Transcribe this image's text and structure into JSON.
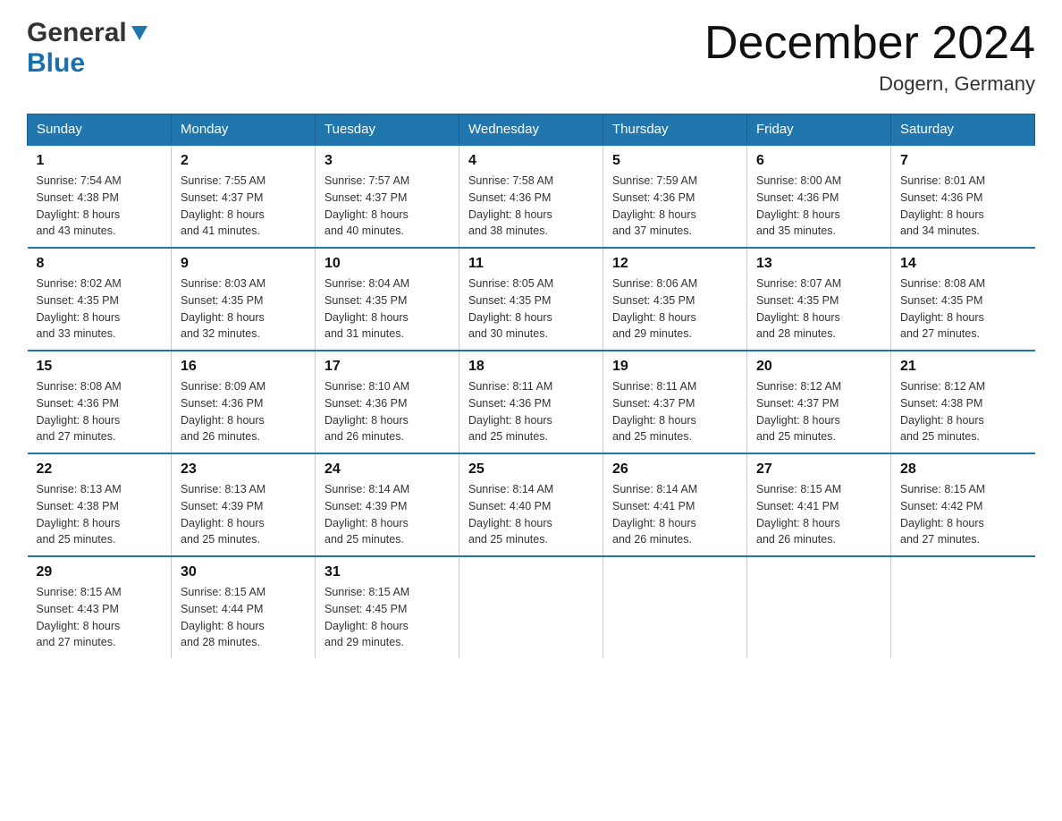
{
  "header": {
    "logo_line1": "General",
    "logo_line2": "Blue",
    "month_title": "December 2024",
    "location": "Dogern, Germany"
  },
  "days_of_week": [
    "Sunday",
    "Monday",
    "Tuesday",
    "Wednesday",
    "Thursday",
    "Friday",
    "Saturday"
  ],
  "weeks": [
    [
      {
        "day": "1",
        "sunrise": "7:54 AM",
        "sunset": "4:38 PM",
        "daylight": "8 hours and 43 minutes."
      },
      {
        "day": "2",
        "sunrise": "7:55 AM",
        "sunset": "4:37 PM",
        "daylight": "8 hours and 41 minutes."
      },
      {
        "day": "3",
        "sunrise": "7:57 AM",
        "sunset": "4:37 PM",
        "daylight": "8 hours and 40 minutes."
      },
      {
        "day": "4",
        "sunrise": "7:58 AM",
        "sunset": "4:36 PM",
        "daylight": "8 hours and 38 minutes."
      },
      {
        "day": "5",
        "sunrise": "7:59 AM",
        "sunset": "4:36 PM",
        "daylight": "8 hours and 37 minutes."
      },
      {
        "day": "6",
        "sunrise": "8:00 AM",
        "sunset": "4:36 PM",
        "daylight": "8 hours and 35 minutes."
      },
      {
        "day": "7",
        "sunrise": "8:01 AM",
        "sunset": "4:36 PM",
        "daylight": "8 hours and 34 minutes."
      }
    ],
    [
      {
        "day": "8",
        "sunrise": "8:02 AM",
        "sunset": "4:35 PM",
        "daylight": "8 hours and 33 minutes."
      },
      {
        "day": "9",
        "sunrise": "8:03 AM",
        "sunset": "4:35 PM",
        "daylight": "8 hours and 32 minutes."
      },
      {
        "day": "10",
        "sunrise": "8:04 AM",
        "sunset": "4:35 PM",
        "daylight": "8 hours and 31 minutes."
      },
      {
        "day": "11",
        "sunrise": "8:05 AM",
        "sunset": "4:35 PM",
        "daylight": "8 hours and 30 minutes."
      },
      {
        "day": "12",
        "sunrise": "8:06 AM",
        "sunset": "4:35 PM",
        "daylight": "8 hours and 29 minutes."
      },
      {
        "day": "13",
        "sunrise": "8:07 AM",
        "sunset": "4:35 PM",
        "daylight": "8 hours and 28 minutes."
      },
      {
        "day": "14",
        "sunrise": "8:08 AM",
        "sunset": "4:35 PM",
        "daylight": "8 hours and 27 minutes."
      }
    ],
    [
      {
        "day": "15",
        "sunrise": "8:08 AM",
        "sunset": "4:36 PM",
        "daylight": "8 hours and 27 minutes."
      },
      {
        "day": "16",
        "sunrise": "8:09 AM",
        "sunset": "4:36 PM",
        "daylight": "8 hours and 26 minutes."
      },
      {
        "day": "17",
        "sunrise": "8:10 AM",
        "sunset": "4:36 PM",
        "daylight": "8 hours and 26 minutes."
      },
      {
        "day": "18",
        "sunrise": "8:11 AM",
        "sunset": "4:36 PM",
        "daylight": "8 hours and 25 minutes."
      },
      {
        "day": "19",
        "sunrise": "8:11 AM",
        "sunset": "4:37 PM",
        "daylight": "8 hours and 25 minutes."
      },
      {
        "day": "20",
        "sunrise": "8:12 AM",
        "sunset": "4:37 PM",
        "daylight": "8 hours and 25 minutes."
      },
      {
        "day": "21",
        "sunrise": "8:12 AM",
        "sunset": "4:38 PM",
        "daylight": "8 hours and 25 minutes."
      }
    ],
    [
      {
        "day": "22",
        "sunrise": "8:13 AM",
        "sunset": "4:38 PM",
        "daylight": "8 hours and 25 minutes."
      },
      {
        "day": "23",
        "sunrise": "8:13 AM",
        "sunset": "4:39 PM",
        "daylight": "8 hours and 25 minutes."
      },
      {
        "day": "24",
        "sunrise": "8:14 AM",
        "sunset": "4:39 PM",
        "daylight": "8 hours and 25 minutes."
      },
      {
        "day": "25",
        "sunrise": "8:14 AM",
        "sunset": "4:40 PM",
        "daylight": "8 hours and 25 minutes."
      },
      {
        "day": "26",
        "sunrise": "8:14 AM",
        "sunset": "4:41 PM",
        "daylight": "8 hours and 26 minutes."
      },
      {
        "day": "27",
        "sunrise": "8:15 AM",
        "sunset": "4:41 PM",
        "daylight": "8 hours and 26 minutes."
      },
      {
        "day": "28",
        "sunrise": "8:15 AM",
        "sunset": "4:42 PM",
        "daylight": "8 hours and 27 minutes."
      }
    ],
    [
      {
        "day": "29",
        "sunrise": "8:15 AM",
        "sunset": "4:43 PM",
        "daylight": "8 hours and 27 minutes."
      },
      {
        "day": "30",
        "sunrise": "8:15 AM",
        "sunset": "4:44 PM",
        "daylight": "8 hours and 28 minutes."
      },
      {
        "day": "31",
        "sunrise": "8:15 AM",
        "sunset": "4:45 PM",
        "daylight": "8 hours and 29 minutes."
      },
      null,
      null,
      null,
      null
    ]
  ],
  "labels": {
    "sunrise": "Sunrise:",
    "sunset": "Sunset:",
    "daylight": "Daylight:"
  }
}
